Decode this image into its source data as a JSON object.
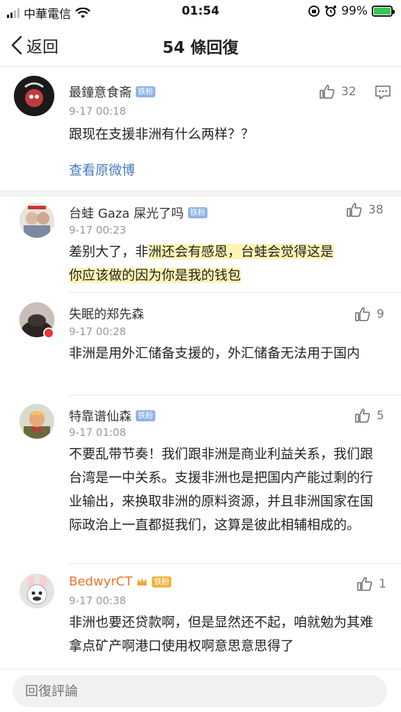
{
  "status_bar": {
    "carrier": "中華電信",
    "time": "01:54",
    "battery": "99%"
  },
  "nav": {
    "back_label": "返回",
    "title": "54 條回復"
  },
  "main_post": {
    "username": "最鐘意食斋",
    "badge": "铁粉",
    "time": "9-17 00:18",
    "text": "跟现在支援非洲有什么两样？？",
    "likes": "32",
    "link": "查看原微博"
  },
  "comments": [
    {
      "username": "台蛙 Gaza 屎光了吗",
      "badge": "铁粉",
      "time": "9-17 00:23",
      "text_pre": "差别大了，非",
      "text_hl1": "洲还会有感恩，台蛙会觉得这是",
      "text_hl2": "你应该做的因为你是我的钱包",
      "likes": "38"
    },
    {
      "username": "失眠的郑先森",
      "time": "9-17 00:28",
      "text": "非洲是用外汇储备支援的，外汇储备无法用于国内",
      "likes": "9"
    },
    {
      "username": "特靠谱仙森",
      "badge": "铁粉",
      "time": "9-17 01:08",
      "text": "不要乱带节奏！我们跟非洲是商业利益关系，我们跟台湾是一中关系。支援非洲也是把国内产能过剩的行业输出，来换取非洲的原料资源，并且非洲国家在国际政治上一直都挺我们，这算是彼此相辅相成的。",
      "likes": "5"
    },
    {
      "username": "BedwyrCT",
      "badge": "铁粉",
      "time": "9-17 00:38",
      "text": "非洲也要还贷款啊，但是显然还不起，咱就勉为其难拿点矿产啊港口使用权啊意思意思得了",
      "likes": "1"
    }
  ],
  "reply_bar": {
    "placeholder": "回復評論"
  },
  "colors": {
    "link": "#4a7ab8",
    "badge": "#8fb4e6",
    "vip_name": "#e8762b",
    "highlight": "#fff3a0"
  }
}
